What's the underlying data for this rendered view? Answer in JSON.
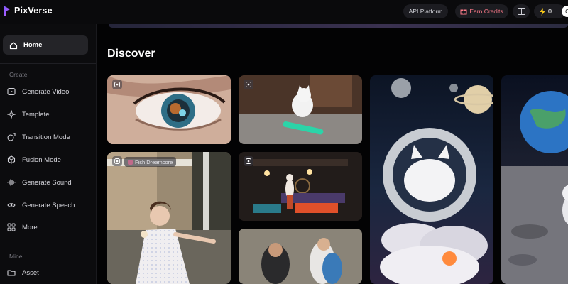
{
  "app": {
    "name": "PixVerse"
  },
  "topbar": {
    "api_platform_label": "API Platform",
    "earn_credits_label": "Earn Credits",
    "energy_count": "0",
    "avatar_initial": "C"
  },
  "sidebar": {
    "home_label": "Home",
    "create_section_label": "Create",
    "items": [
      {
        "label": "Generate Video",
        "icon": "video-icon"
      },
      {
        "label": "Template",
        "icon": "sparkle-icon"
      },
      {
        "label": "Transition Mode",
        "icon": "transition-icon"
      },
      {
        "label": "Fusion Mode",
        "icon": "fusion-icon"
      },
      {
        "label": "Generate Sound",
        "icon": "sound-wave-icon"
      },
      {
        "label": "Generate Speech",
        "icon": "speech-icon"
      },
      {
        "label": "More",
        "icon": "grid-icon"
      }
    ],
    "mine_section_label": "Mine",
    "asset_label": "Asset"
  },
  "main": {
    "title": "Discover",
    "cards": [
      {
        "subject": "eye close-up"
      },
      {
        "subject": "kitten on skateboard"
      },
      {
        "subject": "astronaut kitten in space"
      },
      {
        "subject": "kitten astronaut on moon"
      },
      {
        "subject": "girl with ice cream",
        "tag": "Fish Dreamcore"
      },
      {
        "subject": "cat in steampunk room"
      },
      {
        "subject": "blurry people"
      }
    ]
  },
  "colors": {
    "accent": "#ff7b8a",
    "background": "#000000",
    "sidebar_active": "#242428",
    "energy": "#f5c518"
  }
}
